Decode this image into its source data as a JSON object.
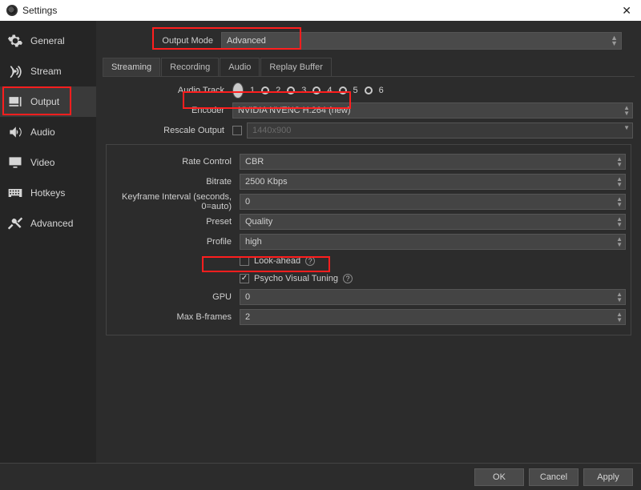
{
  "title": "Settings",
  "sidebar": {
    "items": [
      {
        "label": "General"
      },
      {
        "label": "Stream"
      },
      {
        "label": "Output"
      },
      {
        "label": "Audio"
      },
      {
        "label": "Video"
      },
      {
        "label": "Hotkeys"
      },
      {
        "label": "Advanced"
      }
    ]
  },
  "output_mode": {
    "label": "Output Mode",
    "value": "Advanced"
  },
  "tabs": [
    "Streaming",
    "Recording",
    "Audio",
    "Replay Buffer"
  ],
  "audio_track": {
    "label": "Audio Track",
    "options": [
      "1",
      "2",
      "3",
      "4",
      "5",
      "6"
    ],
    "selected": 0
  },
  "encoder": {
    "label": "Encoder",
    "value": "NVIDIA NVENC H.264 (new)"
  },
  "rescale": {
    "label": "Rescale Output",
    "value": "1440x900",
    "checked": false
  },
  "encset": {
    "rate_control": {
      "label": "Rate Control",
      "value": "CBR"
    },
    "bitrate": {
      "label": "Bitrate",
      "value": "2500 Kbps"
    },
    "keyframe": {
      "label": "Keyframe Interval (seconds, 0=auto)",
      "value": "0"
    },
    "preset": {
      "label": "Preset",
      "value": "Quality"
    },
    "profile": {
      "label": "Profile",
      "value": "high"
    },
    "lookahead": {
      "label": "Look-ahead",
      "checked": false
    },
    "pvt": {
      "label": "Psycho Visual Tuning",
      "checked": true
    },
    "gpu": {
      "label": "GPU",
      "value": "0"
    },
    "max_b": {
      "label": "Max B-frames",
      "value": "2"
    }
  },
  "footer": {
    "ok": "OK",
    "cancel": "Cancel",
    "apply": "Apply"
  }
}
